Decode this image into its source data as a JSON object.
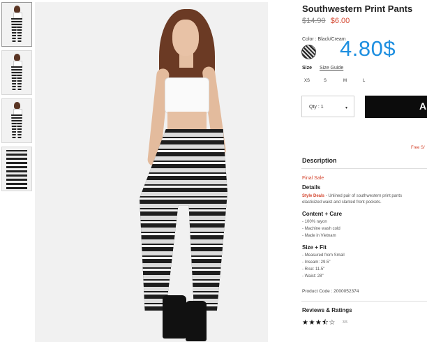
{
  "product": {
    "title": "Southwestern Print Pants",
    "price_old": "$14.90",
    "price_new": "$6.00",
    "overlay_price": "4.80$"
  },
  "color": {
    "label": "Color : Black/Cream",
    "swatch_icon": "black-cream-print-swatch"
  },
  "size": {
    "label": "Size",
    "guide_label": "Size Guide",
    "options": [
      "XS",
      "S",
      "M",
      "L"
    ]
  },
  "quantity": {
    "label": "Qty : 1",
    "caret": "▾"
  },
  "free_shipping": "Free S/",
  "description": {
    "heading": "Description",
    "final_sale": "Final Sale",
    "details_heading": "Details",
    "details_brand": "Style Deals",
    "details_line1": " - Unlined pair of southwestern print pants",
    "details_line2": "elasticized waist and slanted front pockets.",
    "content_heading": "Content + Care",
    "content_items": [
      "- 100% rayon",
      "- Machine wash cold",
      "- Made in Vietnam"
    ],
    "fit_heading": "Size + Fit",
    "fit_items": [
      "- Measured from Small",
      "- Inseam: 29.5\"",
      "- Rise: 11.5\"",
      "- Waist: 28\""
    ],
    "product_code": "Product Code : 2000052374"
  },
  "reviews": {
    "heading": "Reviews & Ratings",
    "stars": "★★★⯪☆",
    "rating": 3.5,
    "rating_label": "3.5"
  }
}
